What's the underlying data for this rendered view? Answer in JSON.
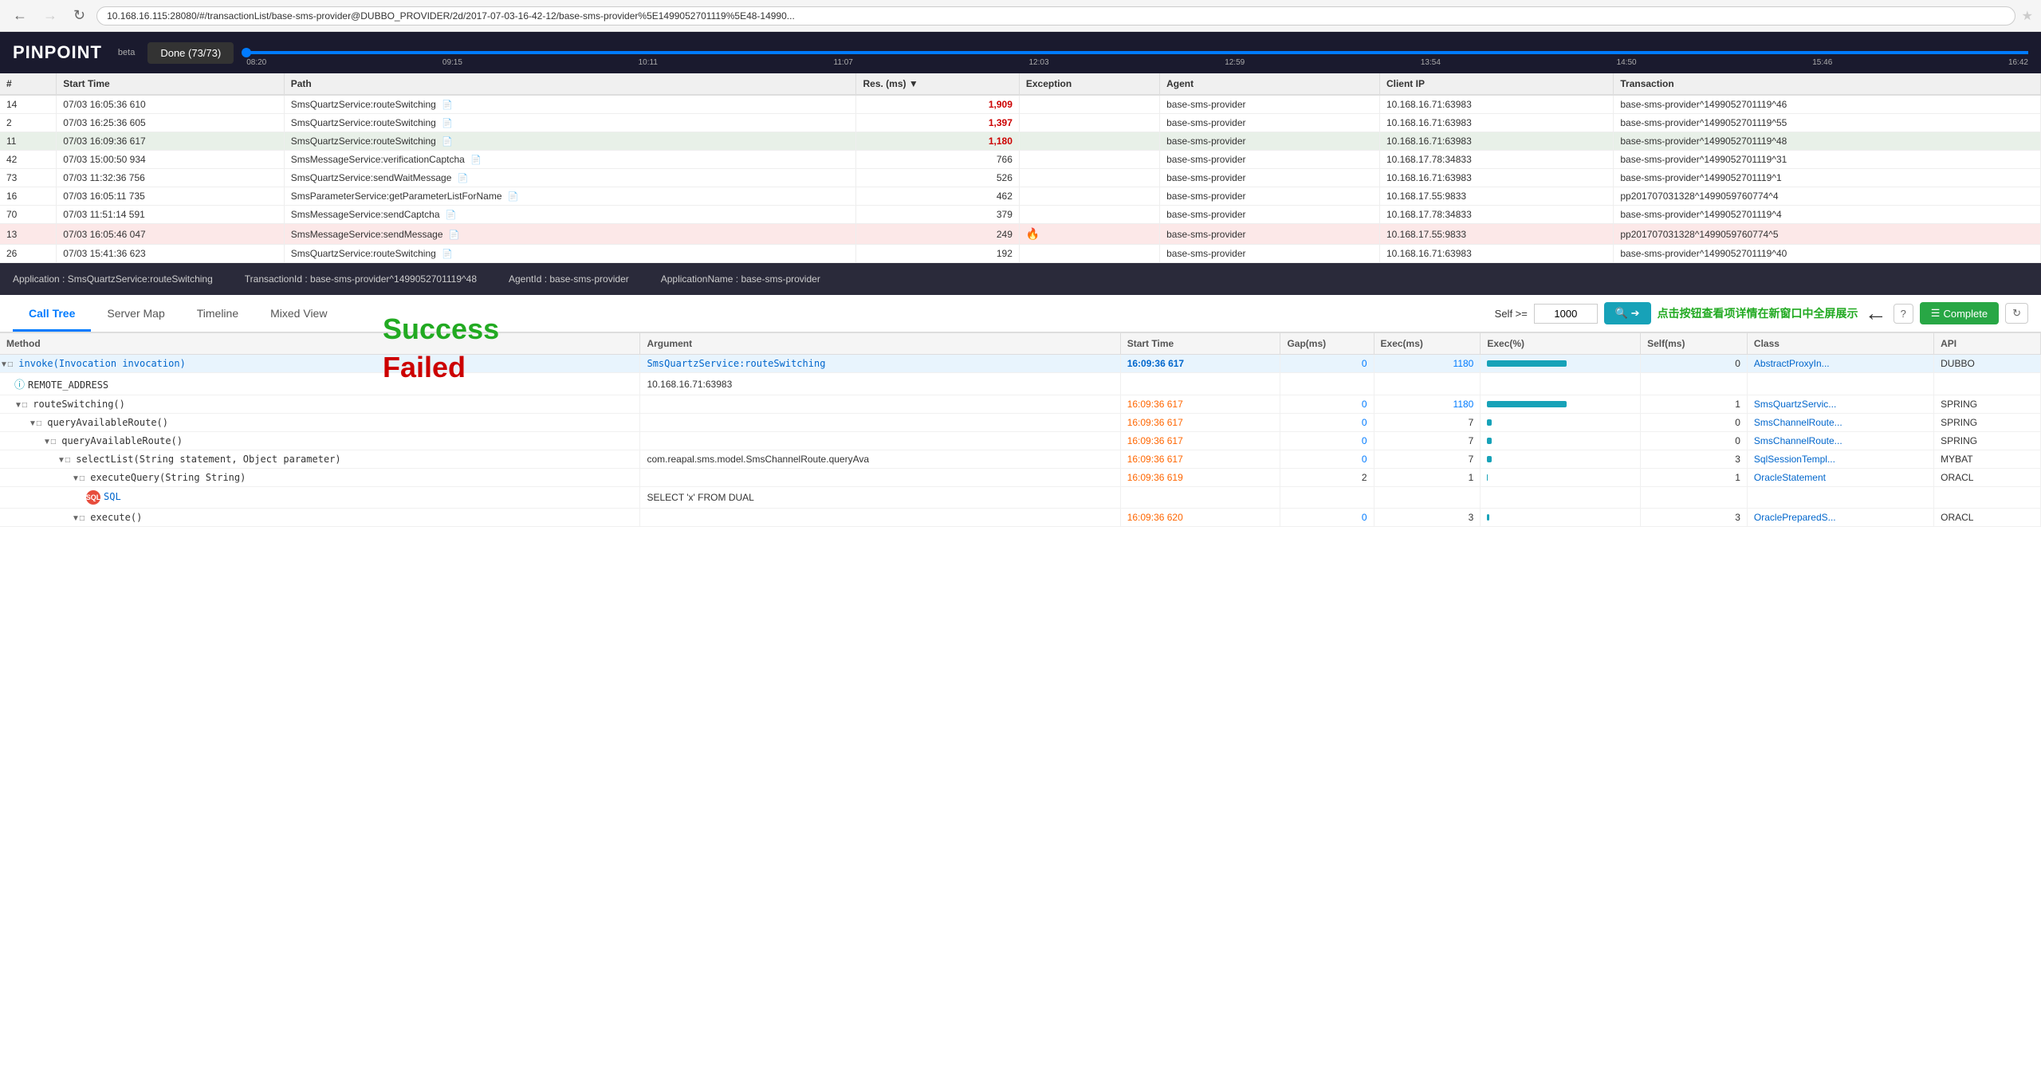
{
  "browser": {
    "url": "10.168.16.115:28080/#/transactionList/base-sms-provider@DUBBO_PROVIDER/2d/2017-07-03-16-42-12/base-sms-provider%5E1499052701119%5E48-14990...",
    "back_disabled": false,
    "forward_disabled": true
  },
  "header": {
    "logo": "PINPOINT",
    "beta": "beta",
    "done_button": "Done (73/73)",
    "timeline_labels": [
      "08:20",
      "09:15",
      "10:11",
      "11:07",
      "12:03",
      "12:59",
      "13:54",
      "14:50",
      "15:46",
      "16:42"
    ]
  },
  "table": {
    "columns": [
      "#",
      "Start Time",
      "Path",
      "Res. (ms)",
      "Exception",
      "Agent",
      "Client IP",
      "Transaction"
    ],
    "rows": [
      {
        "num": "14",
        "start": "07/03 16:05:36 610",
        "path": "SmsQuartzService:routeSwitching",
        "res": "1,909",
        "exception": "",
        "agent": "base-sms-provider",
        "ip": "10.168.16.71:63983",
        "tx": "base-sms-provider^1499052701119^46",
        "selected": false,
        "failed": false
      },
      {
        "num": "2",
        "start": "07/03 16:25:36 605",
        "path": "SmsQuartzService:routeSwitching",
        "res": "1,397",
        "exception": "",
        "agent": "base-sms-provider",
        "ip": "10.168.16.71:63983",
        "tx": "base-sms-provider^1499052701119^55",
        "selected": false,
        "failed": false
      },
      {
        "num": "11",
        "start": "07/03 16:09:36 617",
        "path": "SmsQuartzService:routeSwitching",
        "res": "1,180",
        "exception": "",
        "agent": "base-sms-provider",
        "ip": "10.168.16.71:63983",
        "tx": "base-sms-provider^1499052701119^48",
        "selected": true,
        "failed": false
      },
      {
        "num": "42",
        "start": "07/03 15:00:50 934",
        "path": "SmsMessageService:verificationCaptcha",
        "res": "766",
        "exception": "",
        "agent": "base-sms-provider",
        "ip": "10.168.17.78:34833",
        "tx": "base-sms-provider^1499052701119^31",
        "selected": false,
        "failed": false
      },
      {
        "num": "73",
        "start": "07/03 11:32:36 756",
        "path": "SmsQuartzService:sendWaitMessage",
        "res": "526",
        "exception": "",
        "agent": "base-sms-provider",
        "ip": "10.168.16.71:63983",
        "tx": "base-sms-provider^1499052701119^1",
        "selected": false,
        "failed": false
      },
      {
        "num": "16",
        "start": "07/03 16:05:11 735",
        "path": "SmsParameterService:getParameterListForName",
        "res": "462",
        "exception": "",
        "agent": "base-sms-provider",
        "ip": "10.168.17.55:9833",
        "tx": "pp201707031328^1499059760774^4",
        "selected": false,
        "failed": false
      },
      {
        "num": "70",
        "start": "07/03 11:51:14 591",
        "path": "SmsMessageService:sendCaptcha",
        "res": "379",
        "exception": "",
        "agent": "base-sms-provider",
        "ip": "10.168.17.78:34833",
        "tx": "base-sms-provider^1499052701119^4",
        "selected": false,
        "failed": false
      },
      {
        "num": "13",
        "start": "07/03 16:05:46 047",
        "path": "SmsMessageService:sendMessage",
        "res": "249",
        "exception": "fire",
        "agent": "base-sms-provider",
        "ip": "10.168.17.55:9833",
        "tx": "pp201707031328^1499059760774^5",
        "selected": false,
        "failed": true
      },
      {
        "num": "26",
        "start": "07/03 15:41:36 623",
        "path": "SmsQuartzService:routeSwitching",
        "res": "192",
        "exception": "",
        "agent": "base-sms-provider",
        "ip": "10.168.16.71:63983",
        "tx": "base-sms-provider^1499052701119^40",
        "selected": false,
        "failed": false
      }
    ],
    "success_label": "Success",
    "failed_label": "Failed"
  },
  "info_bar": {
    "application": "Application : SmsQuartzService:routeSwitching",
    "transaction_id": "TransactionId : base-sms-provider^1499052701119^48",
    "agent_id": "AgentId : base-sms-provider",
    "app_name": "ApplicationName : base-sms-provider"
  },
  "tabs": {
    "items": [
      "Call Tree",
      "Server Map",
      "Timeline",
      "Mixed View"
    ],
    "active": "Call Tree",
    "self_label": "Self >=",
    "self_value": "1000",
    "hint_text": "点击按钮查看项详情在新窗口中全屏展示",
    "complete_label": "Complete",
    "search_placeholder": ""
  },
  "calltree": {
    "columns": [
      "Method",
      "Argument",
      "Start Time",
      "Gap(ms)",
      "Exec(ms)",
      "Exec(%)",
      "Self(ms)",
      "Class",
      "API"
    ],
    "rows": [
      {
        "indent": 0,
        "expand": true,
        "method": "invoke(Invocation invocation)",
        "argument": "SmsQuartzService:routeSwitching",
        "start": "16:09:36 617",
        "gap": "0",
        "exec": "1180",
        "exec_pct": 100,
        "self": "0",
        "class": "AbstractProxyIn...",
        "api": "DUBBO",
        "selected": true,
        "is_link": true,
        "arg_link": true
      },
      {
        "indent": 1,
        "expand": false,
        "method": "REMOTE_ADDRESS",
        "argument": "10.168.16.71:63983",
        "start": "",
        "gap": "",
        "exec": "",
        "exec_pct": 0,
        "self": "",
        "class": "",
        "api": "",
        "selected": false,
        "is_info": true
      },
      {
        "indent": 1,
        "expand": true,
        "method": "routeSwitching()",
        "argument": "",
        "start": "16:09:36 617",
        "gap": "0",
        "exec": "1180",
        "exec_pct": 100,
        "self": "1",
        "class": "SmsQuartzServic...",
        "api": "SPRING",
        "selected": false
      },
      {
        "indent": 2,
        "expand": true,
        "method": "queryAvailableRoute()",
        "argument": "",
        "start": "16:09:36 617",
        "gap": "0",
        "exec": "7",
        "exec_pct": 6,
        "self": "0",
        "class": "SmsChannelRoute...",
        "api": "SPRING",
        "selected": false
      },
      {
        "indent": 3,
        "expand": true,
        "method": "queryAvailableRoute()",
        "argument": "",
        "start": "16:09:36 617",
        "gap": "0",
        "exec": "7",
        "exec_pct": 6,
        "self": "0",
        "class": "SmsChannelRoute...",
        "api": "SPRING",
        "selected": false
      },
      {
        "indent": 4,
        "expand": true,
        "method": "selectList(String statement, Object parameter)",
        "argument": "com.reapal.sms.model.SmsChannelRoute.queryAva",
        "start": "16:09:36 617",
        "gap": "0",
        "exec": "7",
        "exec_pct": 6,
        "self": "3",
        "class": "SqlSessionTempl...",
        "api": "MYBAT",
        "selected": false
      },
      {
        "indent": 5,
        "expand": true,
        "method": "executeQuery(String String)",
        "argument": "",
        "start": "16:09:36 619",
        "gap": "2",
        "exec": "1",
        "exec_pct": 1,
        "self": "1",
        "class": "OracleStatement",
        "api": "ORACL",
        "selected": false
      },
      {
        "indent": 6,
        "expand": false,
        "method": "SQL",
        "argument": "SELECT 'x' FROM DUAL",
        "start": "",
        "gap": "",
        "exec": "",
        "exec_pct": 0,
        "self": "",
        "class": "",
        "api": "",
        "selected": false,
        "is_sql": true
      },
      {
        "indent": 5,
        "expand": true,
        "method": "execute()",
        "argument": "",
        "start": "16:09:36 620",
        "gap": "0",
        "exec": "3",
        "exec_pct": 3,
        "self": "3",
        "class": "OraclePreparedS...",
        "api": "ORACL",
        "selected": false
      }
    ]
  }
}
